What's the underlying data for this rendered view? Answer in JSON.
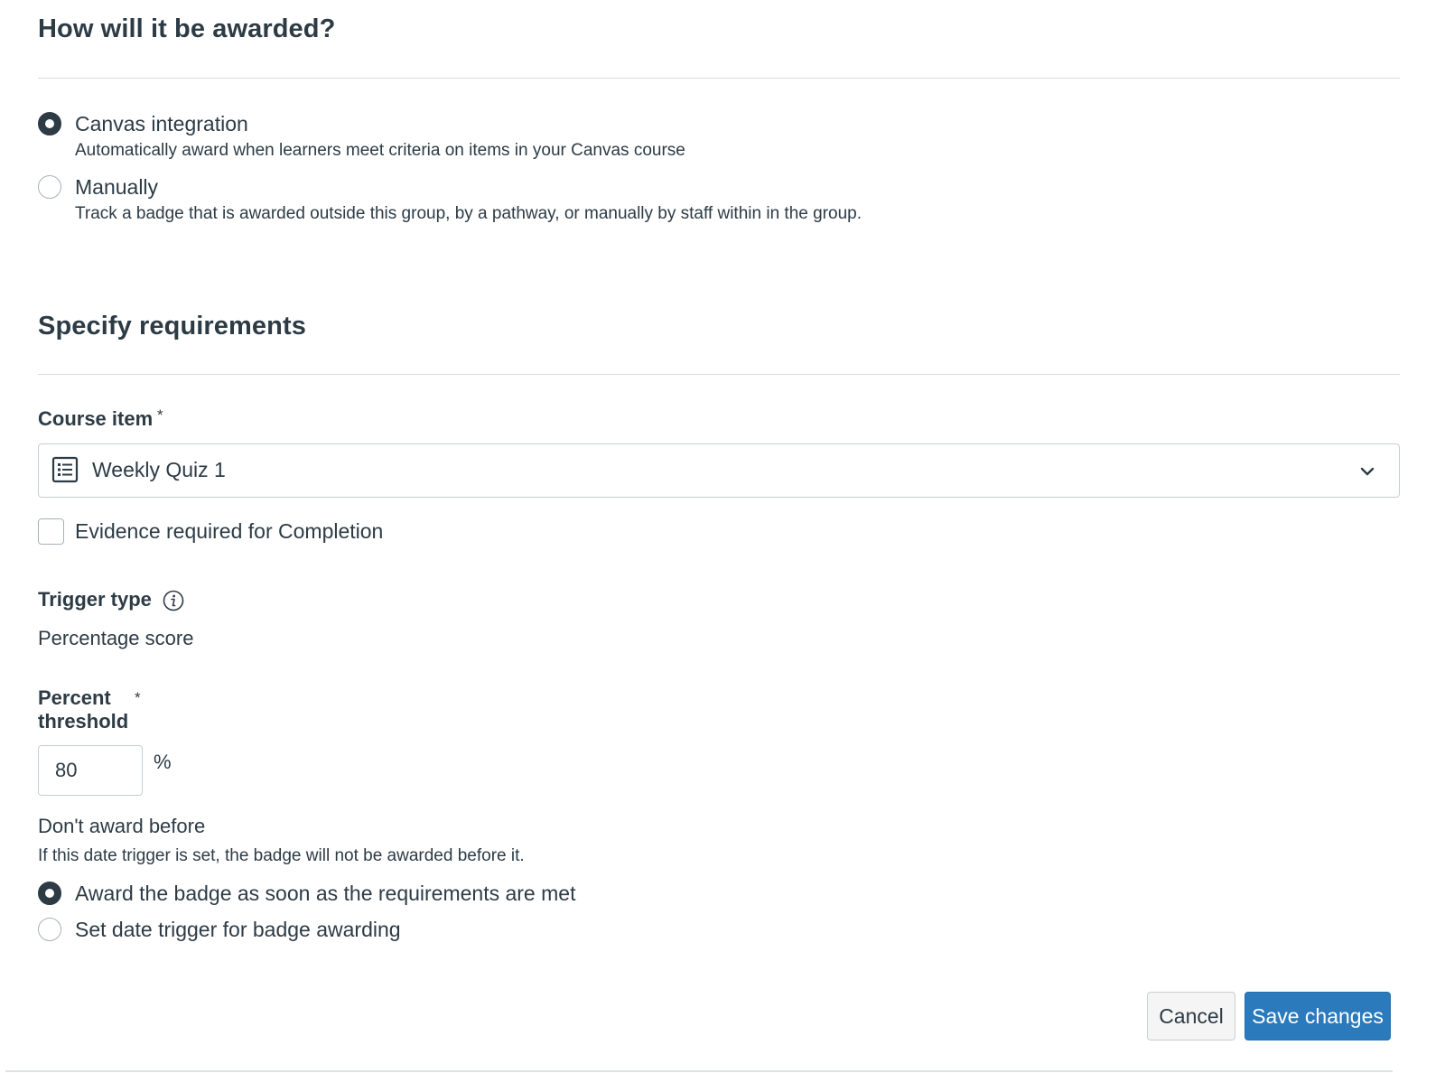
{
  "award_section": {
    "title": "How will it be awarded?",
    "options": [
      {
        "label": "Canvas integration",
        "description": "Automatically award when learners meet criteria on items in your Canvas course",
        "selected": true
      },
      {
        "label": "Manually",
        "description": "Track a badge that is awarded outside this group, by a pathway, or manually by staff within in the group.",
        "selected": false
      }
    ]
  },
  "requirements_section": {
    "title": "Specify requirements",
    "course_item": {
      "label": "Course item",
      "required_mark": "*",
      "value": "Weekly Quiz 1",
      "icon": "quiz-list-icon"
    },
    "evidence_checkbox": {
      "label": "Evidence required for Completion",
      "checked": false
    },
    "trigger_type": {
      "label": "Trigger type",
      "value": "Percentage score",
      "icon": "info-icon"
    },
    "percent_threshold": {
      "label_line1": "Percent",
      "label_line2": "threshold",
      "required_mark": "*",
      "value": "80",
      "unit": "%"
    },
    "dont_award_before": {
      "label": "Don't award before",
      "description": "If this date trigger is set, the badge will not be awarded before it.",
      "options": [
        {
          "label": "Award the badge as soon as the requirements are met",
          "selected": true
        },
        {
          "label": "Set date trigger for badge awarding",
          "selected": false
        }
      ]
    }
  },
  "actions": {
    "cancel_label": "Cancel",
    "save_label": "Save changes"
  },
  "colors": {
    "text": "#2d3b45",
    "primary": "#2b7abc",
    "border": "#c7cdd1",
    "divider": "#d9dcde"
  }
}
